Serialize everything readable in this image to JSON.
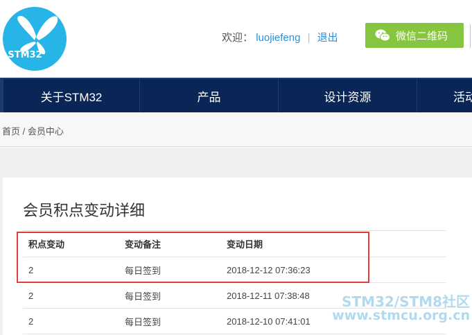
{
  "header": {
    "logo_text": "STM32",
    "welcome_label": "欢迎：",
    "username": "luojiefeng",
    "separator": "|",
    "logout_label": "退出",
    "wechat_button_label": "微信二维码"
  },
  "nav": {
    "items": [
      "关于STM32",
      "产品",
      "设计资源",
      "活动"
    ]
  },
  "breadcrumb": {
    "text": "首页 / 会员中心"
  },
  "main": {
    "title": "会员积点变动详细",
    "table": {
      "headers": [
        "积点变动",
        "变动备注",
        "变动日期"
      ],
      "rows": [
        [
          "2",
          "每日签到",
          "2018-12-12 07:36:23"
        ],
        [
          "2",
          "每日签到",
          "2018-12-11 07:38:48"
        ],
        [
          "2",
          "每日签到",
          "2018-12-10 07:41:01"
        ]
      ]
    }
  },
  "watermark": {
    "line1": "STM32/STM8社区",
    "line2": "www.stmcu.org.cn"
  },
  "colors": {
    "nav_bg": "#0a2656",
    "logo_bg": "#27b4e6",
    "wechat_bg": "#85c540",
    "link": "#2b8fd6",
    "highlight_border": "#e23b3b"
  },
  "icons": {
    "logo": "butterfly-logo-icon",
    "wechat": "wechat-icon"
  }
}
